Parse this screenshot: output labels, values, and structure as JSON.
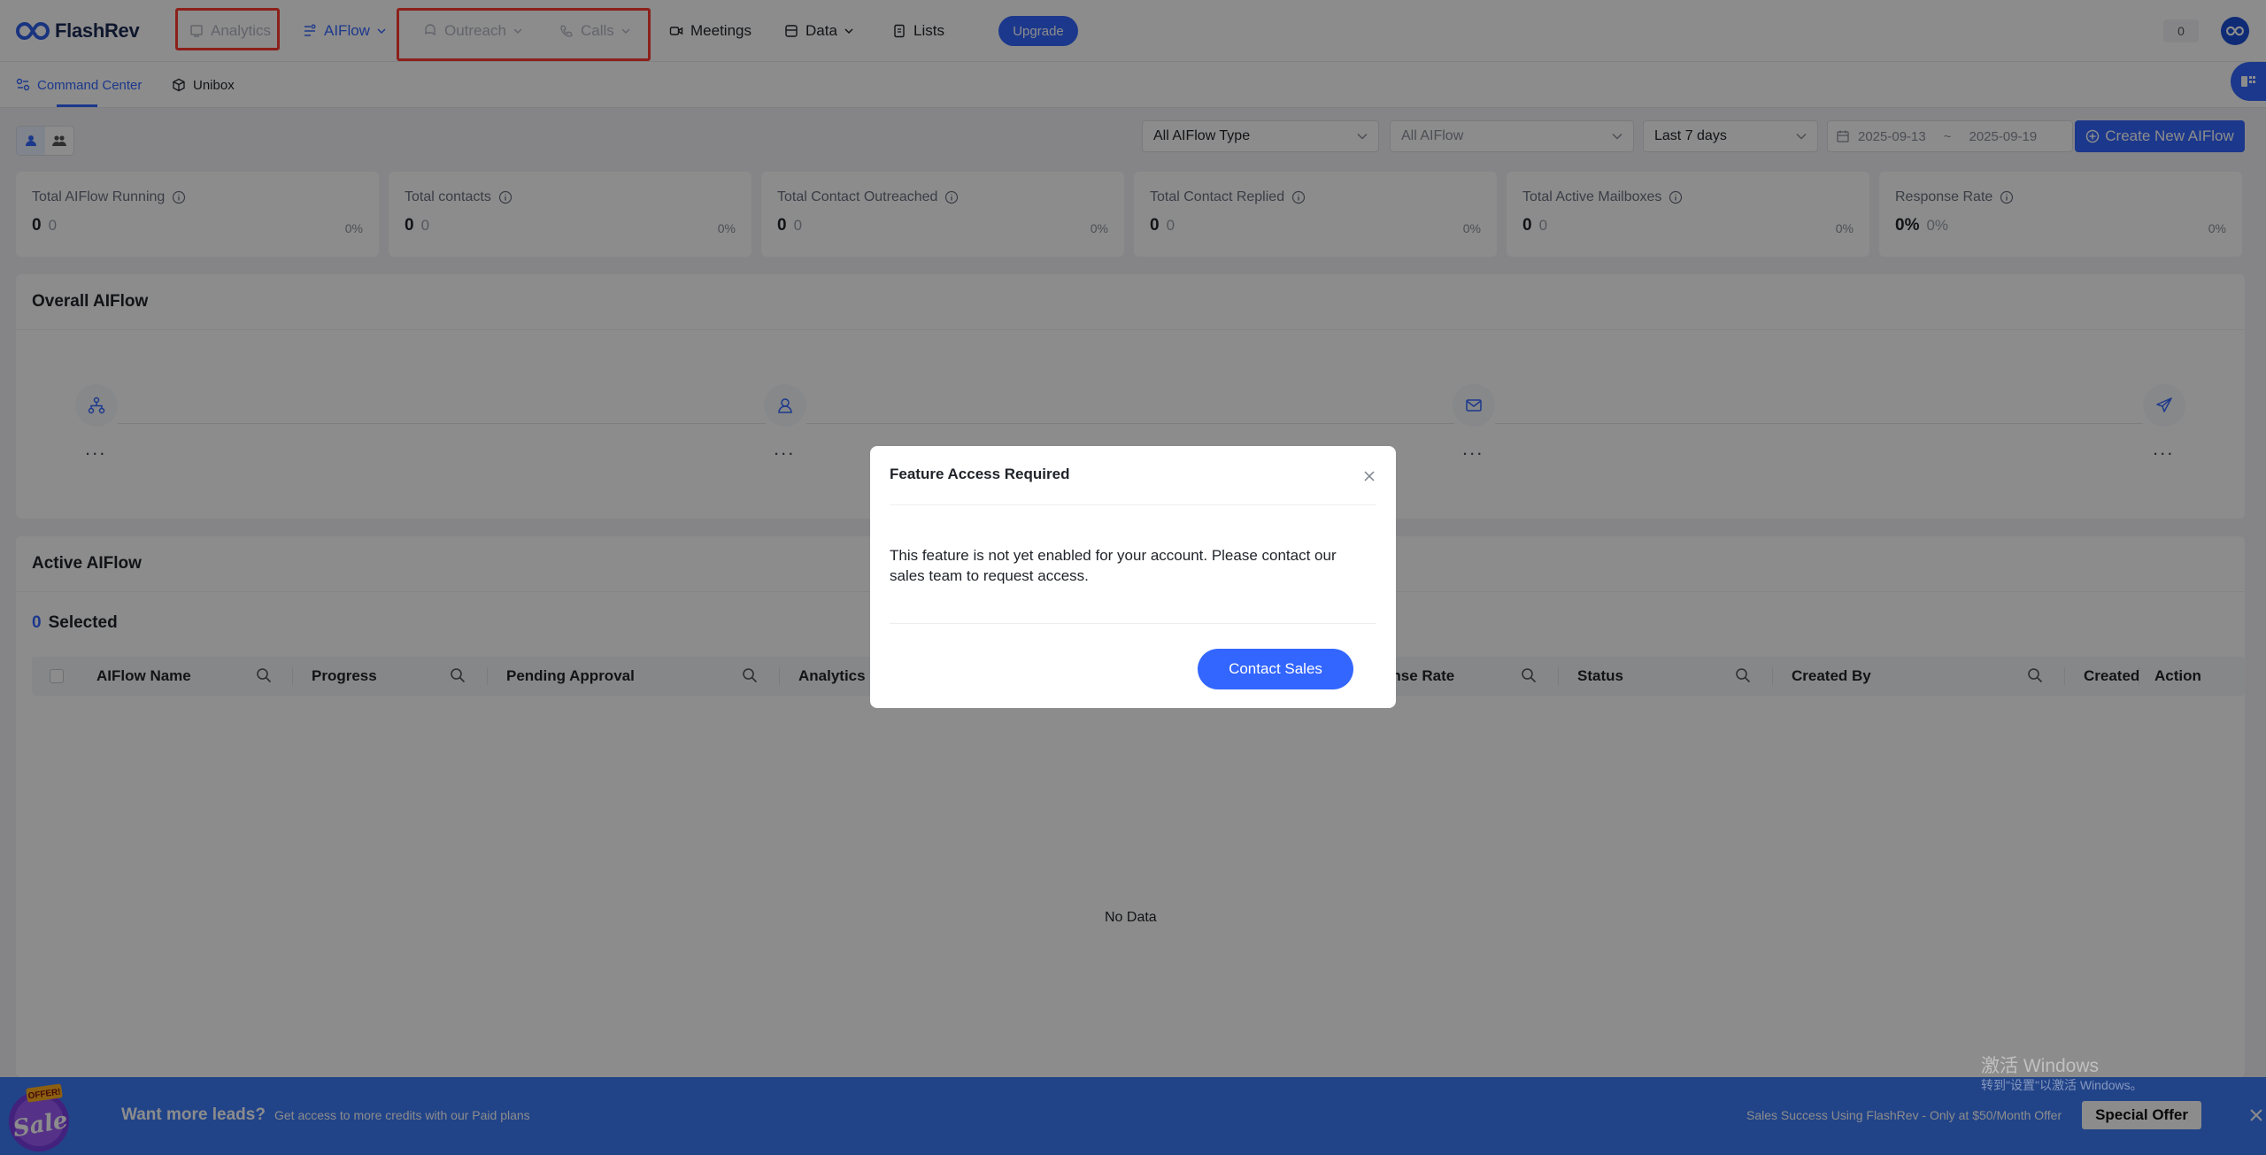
{
  "brand": {
    "name": "FlashRev"
  },
  "nav": {
    "analytics": "Analytics",
    "aiflow": "AIFlow",
    "outreach": "Outreach",
    "calls": "Calls",
    "meetings": "Meetings",
    "data": "Data",
    "lists": "Lists",
    "upgrade": "Upgrade",
    "credit_count": "0"
  },
  "subtabs": {
    "command_center": "Command Center",
    "unibox": "Unibox"
  },
  "filters": {
    "aiflow_type": "All AIFlow Type",
    "aiflow": "All AIFlow",
    "period": "Last 7 days",
    "date_start": "2025-09-13",
    "date_sep": "~",
    "date_end": "2025-09-19",
    "create_button": "Create New AIFlow"
  },
  "stats": [
    {
      "label": "Total AIFlow Running",
      "value": "0",
      "prev": "0",
      "pct": "0%"
    },
    {
      "label": "Total contacts",
      "value": "0",
      "prev": "0",
      "pct": "0%"
    },
    {
      "label": "Total Contact Outreached",
      "value": "0",
      "prev": "0",
      "pct": "0%"
    },
    {
      "label": "Total Contact Replied",
      "value": "0",
      "prev": "0",
      "pct": "0%"
    },
    {
      "label": "Total Active Mailboxes",
      "value": "0",
      "prev": "0",
      "pct": "0%"
    },
    {
      "label": "Response Rate",
      "value": "0%",
      "prev": "0%",
      "pct": "0%"
    }
  ],
  "overall": {
    "title": "Overall AIFlow",
    "steps": [
      {
        "icon": "workflow-icon",
        "value": "..."
      },
      {
        "icon": "contact-icon",
        "value": "..."
      },
      {
        "icon": "mail-icon",
        "value": "..."
      },
      {
        "icon": "send-icon",
        "value": "..."
      }
    ]
  },
  "active": {
    "title": "Active AIFlow",
    "selected_count": "0",
    "selected_label": "Selected",
    "columns": {
      "name": "AIFlow Name",
      "progress": "Progress",
      "pending": "Pending Approval",
      "analytics": "Analytics",
      "response_rate": "onse Rate",
      "status": "Status",
      "created_by": "Created By",
      "created": "Created",
      "action": "Action"
    },
    "empty_text": "No Data"
  },
  "modal": {
    "title": "Feature Access Required",
    "body": "This feature is not yet enabled for your account. Please contact our sales team to request access.",
    "button": "Contact Sales"
  },
  "watermark": {
    "line1": "激活 Windows",
    "line2": "转到\"设置\"以激活 Windows。"
  },
  "promo": {
    "badge_top": "OFFER!",
    "badge_main": "Sale",
    "headline": "Want more leads?",
    "subtext": "Get access to more credits with our Paid plans",
    "right_text": "Sales Success Using FlashRev - Only at $50/Month Offer",
    "button": "Special Offer"
  },
  "colors": {
    "primary": "#3366ff",
    "banner": "#3d7bf7",
    "highlight": "#ff3b30"
  }
}
